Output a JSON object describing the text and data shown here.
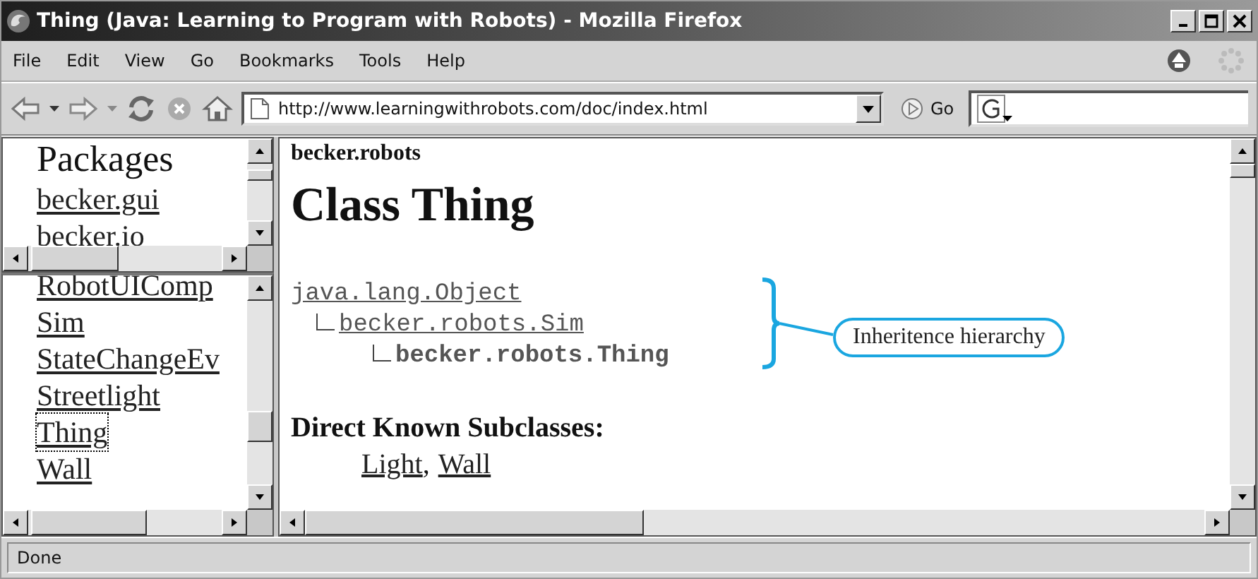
{
  "window": {
    "title": "Thing (Java: Learning to Program with Robots) - Mozilla Firefox"
  },
  "menu": [
    {
      "label": "File"
    },
    {
      "label": "Edit"
    },
    {
      "label": "View"
    },
    {
      "label": "Go"
    },
    {
      "label": "Bookmarks"
    },
    {
      "label": "Tools"
    },
    {
      "label": "Help"
    }
  ],
  "toolbar": {
    "url": "http://www.learningwithrobots.com/doc/index.html",
    "go": "Go"
  },
  "packages_frame": {
    "heading": "Packages",
    "items": [
      "becker.gui",
      "becker.io"
    ]
  },
  "classes_frame": {
    "items": [
      {
        "label": "RobotUIComp",
        "selected": false
      },
      {
        "label": "Sim",
        "selected": false
      },
      {
        "label": "StateChangeEv",
        "selected": false
      },
      {
        "label": "Streetlight",
        "selected": false
      },
      {
        "label": "Thing",
        "selected": true
      },
      {
        "label": "Wall",
        "selected": false
      }
    ]
  },
  "content": {
    "package": "becker.robots",
    "title": "Class Thing",
    "hierarchy": [
      {
        "name": "java.lang.Object",
        "current": false,
        "children": [
          {
            "name": "becker.robots.Sim",
            "current": false,
            "children": [
              {
                "name": "becker.robots.Thing",
                "current": true
              }
            ]
          }
        ]
      }
    ],
    "subclasses_heading": "Direct Known Subclasses:",
    "subclasses": [
      "Light",
      "Wall"
    ],
    "subclass_separator": ","
  },
  "callout": {
    "label": "Inheritence hierarchy"
  },
  "status_bar": {
    "text": "Done"
  }
}
